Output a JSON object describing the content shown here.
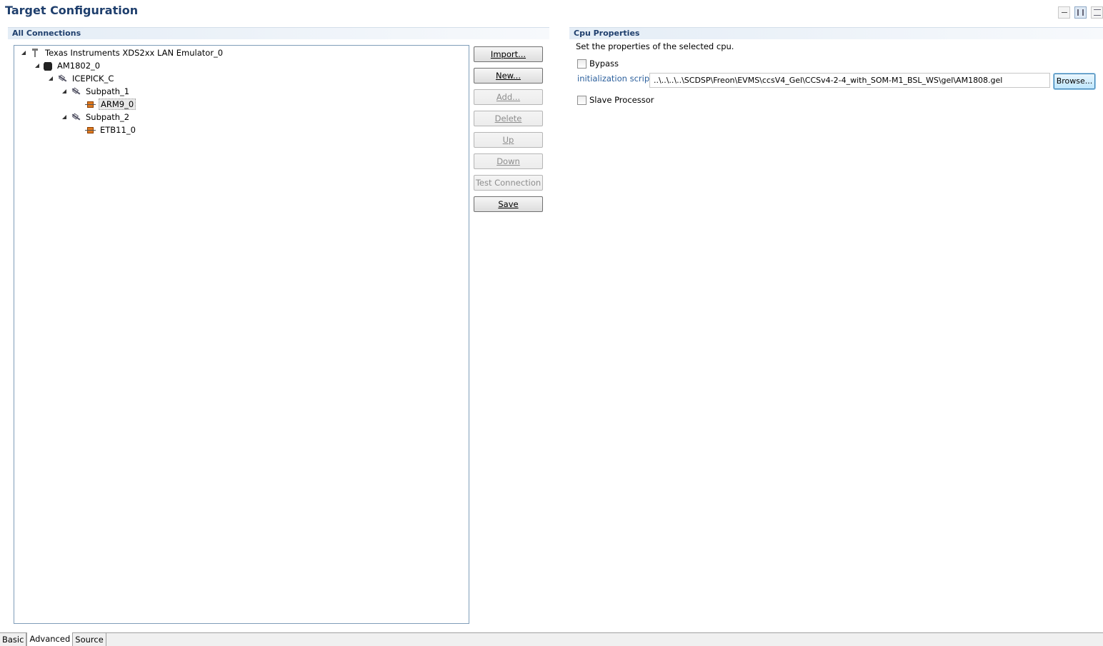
{
  "form": {
    "title": "Target Configuration"
  },
  "connections": {
    "header": "All Connections",
    "tree": [
      {
        "label": "Texas Instruments XDS2xx LAN Emulator_0",
        "icon": "emulator-icon",
        "level": 0,
        "expanded": true,
        "selected": false
      },
      {
        "label": "AM1802_0",
        "icon": "chip-icon",
        "level": 1,
        "expanded": true,
        "selected": false
      },
      {
        "label": "ICEPICK_C",
        "icon": "router-icon",
        "level": 2,
        "expanded": true,
        "selected": false
      },
      {
        "label": "Subpath_1",
        "icon": "router-icon",
        "level": 3,
        "expanded": true,
        "selected": false
      },
      {
        "label": "ARM9_0",
        "icon": "cpu-icon",
        "level": 4,
        "expanded": false,
        "selected": true
      },
      {
        "label": "Subpath_2",
        "icon": "router-icon",
        "level": 3,
        "expanded": true,
        "selected": false
      },
      {
        "label": "ETB11_0",
        "icon": "cpu-icon",
        "level": 4,
        "expanded": false,
        "selected": false
      }
    ],
    "buttons": {
      "import": "Import...",
      "new": "New...",
      "add": "Add...",
      "delete": "Delete",
      "up": "Up",
      "down": "Down",
      "test": "Test Connection",
      "save": "Save"
    }
  },
  "cpu": {
    "header": "Cpu Properties",
    "description": "Set the properties of the selected cpu.",
    "bypass_label": "Bypass",
    "bypass_checked": false,
    "init_label": "initialization script",
    "init_value": "..\\..\\..\\..\\SCDSP\\Freon\\EVMS\\ccsV4_Gel\\CCSv4-2-4_with_SOM-M1_BSL_WS\\gel\\AM1808.gel",
    "browse_label": "Browse...",
    "slave_label": "Slave Processor",
    "slave_checked": false
  },
  "tabs": [
    "Basic",
    "Advanced",
    "Source"
  ],
  "active_tab": "Advanced"
}
